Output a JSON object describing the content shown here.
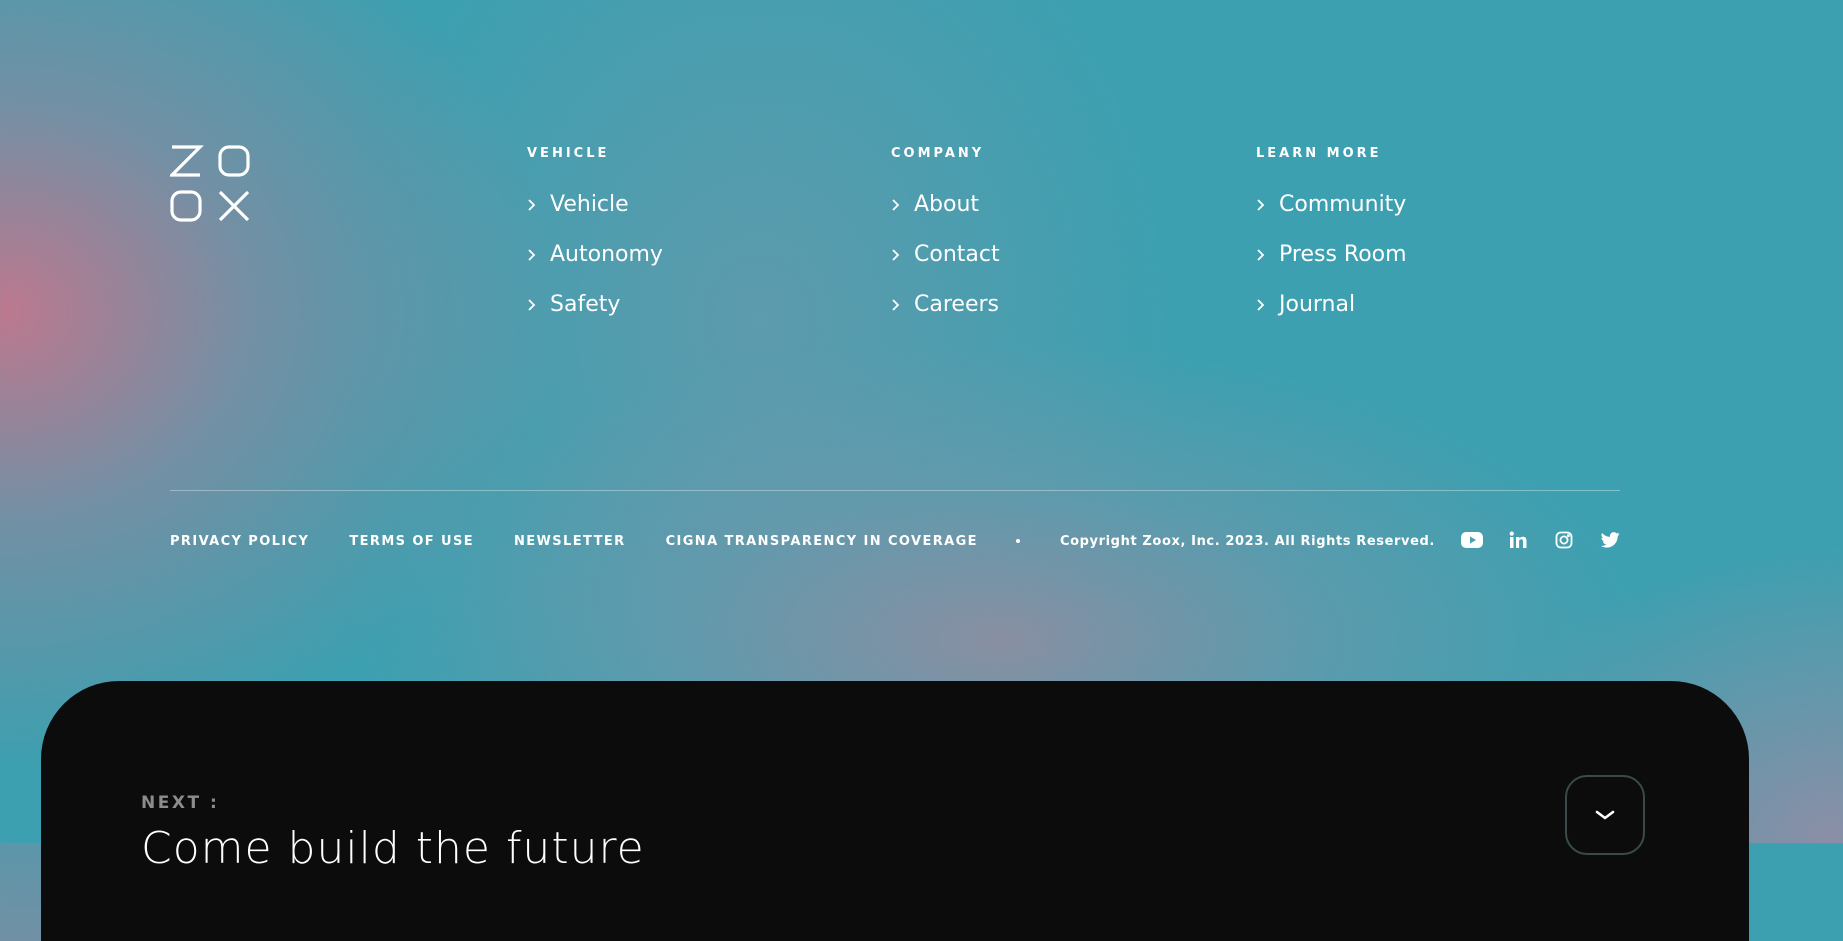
{
  "brand": {
    "name": "ZOOX"
  },
  "nav_columns": [
    {
      "heading": "VEHICLE",
      "links": [
        "Vehicle",
        "Autonomy",
        "Safety"
      ]
    },
    {
      "heading": "COMPANY",
      "links": [
        "About",
        "Contact",
        "Careers"
      ]
    },
    {
      "heading": "LEARN MORE",
      "links": [
        "Community",
        "Press Room",
        "Journal"
      ]
    }
  ],
  "legal": {
    "links": [
      "PRIVACY POLICY",
      "TERMS OF USE",
      "NEWSLETTER",
      "CIGNA TRANSPARENCY IN COVERAGE"
    ],
    "copyright": "Copyright Zoox, Inc. 2023. All Rights Reserved."
  },
  "social": [
    "youtube-icon",
    "linkedin-icon",
    "instagram-icon",
    "twitter-icon"
  ],
  "next": {
    "label": "NEXT :",
    "title": "Come build the future"
  },
  "colors": {
    "background": "#3ca0b0",
    "panel": "#0c0c0d",
    "accent_pink": "#c4768c"
  }
}
